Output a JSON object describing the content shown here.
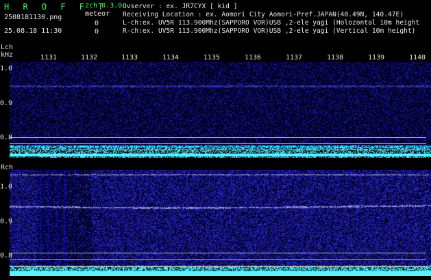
{
  "header": {
    "app_title": "H R O F F T",
    "channels": "2ch 0.3.0",
    "filename": "2508181130.png",
    "meteor_label": "meteor",
    "timestamp": "25.08.18 11:30",
    "lch_count": "0",
    "rch_count": "0",
    "observer": "Ovserver            : ex. JR7CYX [ kid ]",
    "location": "Receiving Location : ex. Aomori City Aomori-Pref.JAPAN(40.49N, 140.47E)",
    "lch_desc": "L-ch:ex. UV5R 113.900Mhz(SAPPORO VOR)USB ,2-ele yagi (Holozontal 10m height",
    "rch_desc": "R-ch:ex. UV5R 113.900Mhz(SAPPORO VOR)USB ,2-ele yagi (Vertical 10m height)"
  },
  "axis": {
    "lch_label": "Lch",
    "khz_label": "kHz",
    "rch_label": "Rch",
    "time_ticks": [
      "1131",
      "1132",
      "1133",
      "1134",
      "1135",
      "1136",
      "1137",
      "1138",
      "1139",
      "1140"
    ],
    "lch_freq_ticks": [
      "1.0",
      "0.9",
      "0.8"
    ],
    "rch_freq_ticks": [
      "1.0",
      "0.9",
      "0.8"
    ]
  },
  "colors": {
    "accent_green": "#39ff5a",
    "noise_blue": "#3a3aff",
    "signal_cyan": "#5ff0ff"
  }
}
